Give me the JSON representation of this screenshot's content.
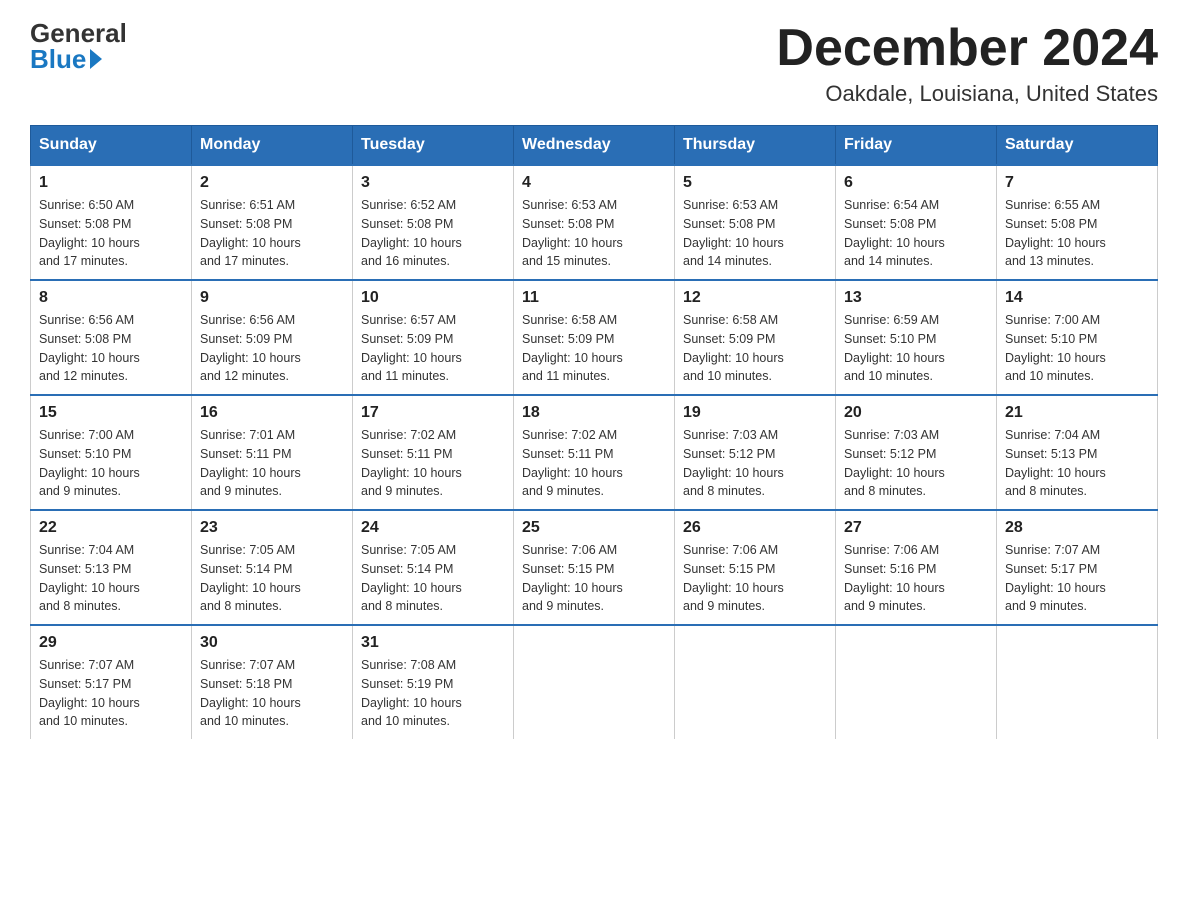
{
  "header": {
    "logo_general": "General",
    "logo_blue": "Blue",
    "month_title": "December 2024",
    "location": "Oakdale, Louisiana, United States"
  },
  "days_of_week": [
    "Sunday",
    "Monday",
    "Tuesday",
    "Wednesday",
    "Thursday",
    "Friday",
    "Saturday"
  ],
  "weeks": [
    [
      {
        "day": "1",
        "sunrise": "6:50 AM",
        "sunset": "5:08 PM",
        "daylight": "10 hours and 17 minutes."
      },
      {
        "day": "2",
        "sunrise": "6:51 AM",
        "sunset": "5:08 PM",
        "daylight": "10 hours and 17 minutes."
      },
      {
        "day": "3",
        "sunrise": "6:52 AM",
        "sunset": "5:08 PM",
        "daylight": "10 hours and 16 minutes."
      },
      {
        "day": "4",
        "sunrise": "6:53 AM",
        "sunset": "5:08 PM",
        "daylight": "10 hours and 15 minutes."
      },
      {
        "day": "5",
        "sunrise": "6:53 AM",
        "sunset": "5:08 PM",
        "daylight": "10 hours and 14 minutes."
      },
      {
        "day": "6",
        "sunrise": "6:54 AM",
        "sunset": "5:08 PM",
        "daylight": "10 hours and 14 minutes."
      },
      {
        "day": "7",
        "sunrise": "6:55 AM",
        "sunset": "5:08 PM",
        "daylight": "10 hours and 13 minutes."
      }
    ],
    [
      {
        "day": "8",
        "sunrise": "6:56 AM",
        "sunset": "5:08 PM",
        "daylight": "10 hours and 12 minutes."
      },
      {
        "day": "9",
        "sunrise": "6:56 AM",
        "sunset": "5:09 PM",
        "daylight": "10 hours and 12 minutes."
      },
      {
        "day": "10",
        "sunrise": "6:57 AM",
        "sunset": "5:09 PM",
        "daylight": "10 hours and 11 minutes."
      },
      {
        "day": "11",
        "sunrise": "6:58 AM",
        "sunset": "5:09 PM",
        "daylight": "10 hours and 11 minutes."
      },
      {
        "day": "12",
        "sunrise": "6:58 AM",
        "sunset": "5:09 PM",
        "daylight": "10 hours and 10 minutes."
      },
      {
        "day": "13",
        "sunrise": "6:59 AM",
        "sunset": "5:10 PM",
        "daylight": "10 hours and 10 minutes."
      },
      {
        "day": "14",
        "sunrise": "7:00 AM",
        "sunset": "5:10 PM",
        "daylight": "10 hours and 10 minutes."
      }
    ],
    [
      {
        "day": "15",
        "sunrise": "7:00 AM",
        "sunset": "5:10 PM",
        "daylight": "10 hours and 9 minutes."
      },
      {
        "day": "16",
        "sunrise": "7:01 AM",
        "sunset": "5:11 PM",
        "daylight": "10 hours and 9 minutes."
      },
      {
        "day": "17",
        "sunrise": "7:02 AM",
        "sunset": "5:11 PM",
        "daylight": "10 hours and 9 minutes."
      },
      {
        "day": "18",
        "sunrise": "7:02 AM",
        "sunset": "5:11 PM",
        "daylight": "10 hours and 9 minutes."
      },
      {
        "day": "19",
        "sunrise": "7:03 AM",
        "sunset": "5:12 PM",
        "daylight": "10 hours and 8 minutes."
      },
      {
        "day": "20",
        "sunrise": "7:03 AM",
        "sunset": "5:12 PM",
        "daylight": "10 hours and 8 minutes."
      },
      {
        "day": "21",
        "sunrise": "7:04 AM",
        "sunset": "5:13 PM",
        "daylight": "10 hours and 8 minutes."
      }
    ],
    [
      {
        "day": "22",
        "sunrise": "7:04 AM",
        "sunset": "5:13 PM",
        "daylight": "10 hours and 8 minutes."
      },
      {
        "day": "23",
        "sunrise": "7:05 AM",
        "sunset": "5:14 PM",
        "daylight": "10 hours and 8 minutes."
      },
      {
        "day": "24",
        "sunrise": "7:05 AM",
        "sunset": "5:14 PM",
        "daylight": "10 hours and 8 minutes."
      },
      {
        "day": "25",
        "sunrise": "7:06 AM",
        "sunset": "5:15 PM",
        "daylight": "10 hours and 9 minutes."
      },
      {
        "day": "26",
        "sunrise": "7:06 AM",
        "sunset": "5:15 PM",
        "daylight": "10 hours and 9 minutes."
      },
      {
        "day": "27",
        "sunrise": "7:06 AM",
        "sunset": "5:16 PM",
        "daylight": "10 hours and 9 minutes."
      },
      {
        "day": "28",
        "sunrise": "7:07 AM",
        "sunset": "5:17 PM",
        "daylight": "10 hours and 9 minutes."
      }
    ],
    [
      {
        "day": "29",
        "sunrise": "7:07 AM",
        "sunset": "5:17 PM",
        "daylight": "10 hours and 10 minutes."
      },
      {
        "day": "30",
        "sunrise": "7:07 AM",
        "sunset": "5:18 PM",
        "daylight": "10 hours and 10 minutes."
      },
      {
        "day": "31",
        "sunrise": "7:08 AM",
        "sunset": "5:19 PM",
        "daylight": "10 hours and 10 minutes."
      },
      null,
      null,
      null,
      null
    ]
  ],
  "labels": {
    "sunrise": "Sunrise:",
    "sunset": "Sunset:",
    "daylight": "Daylight:"
  }
}
